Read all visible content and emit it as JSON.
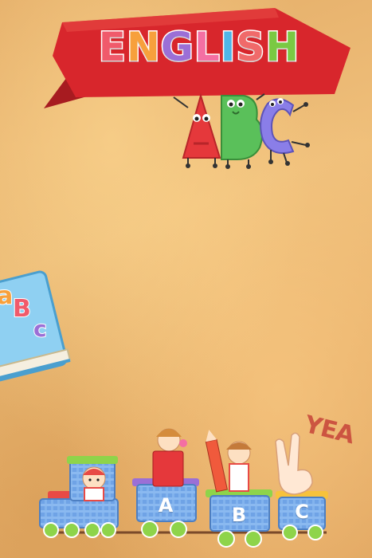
{
  "banner": {
    "title_letters": [
      "E",
      "N",
      "G",
      "L",
      "I",
      "S",
      "H"
    ],
    "title_colors": [
      "#f05a6b",
      "#f7a03c",
      "#9b6fd6",
      "#f46fa3",
      "#4fb5e8",
      "#f06a6a",
      "#7ac943"
    ]
  },
  "abc_characters": [
    "A",
    "B",
    "C"
  ],
  "book": {
    "letters": [
      "a",
      "B",
      "c"
    ]
  },
  "train": {
    "wagon_letters": [
      "A",
      "B",
      "C"
    ]
  },
  "scribble": "YEA",
  "colors": {
    "banner_red": "#d8262c",
    "letter_a": "#e5383b",
    "letter_b": "#5ac05a",
    "letter_c": "#8a7ee8",
    "wagon_blue": "#6fa3e6"
  }
}
